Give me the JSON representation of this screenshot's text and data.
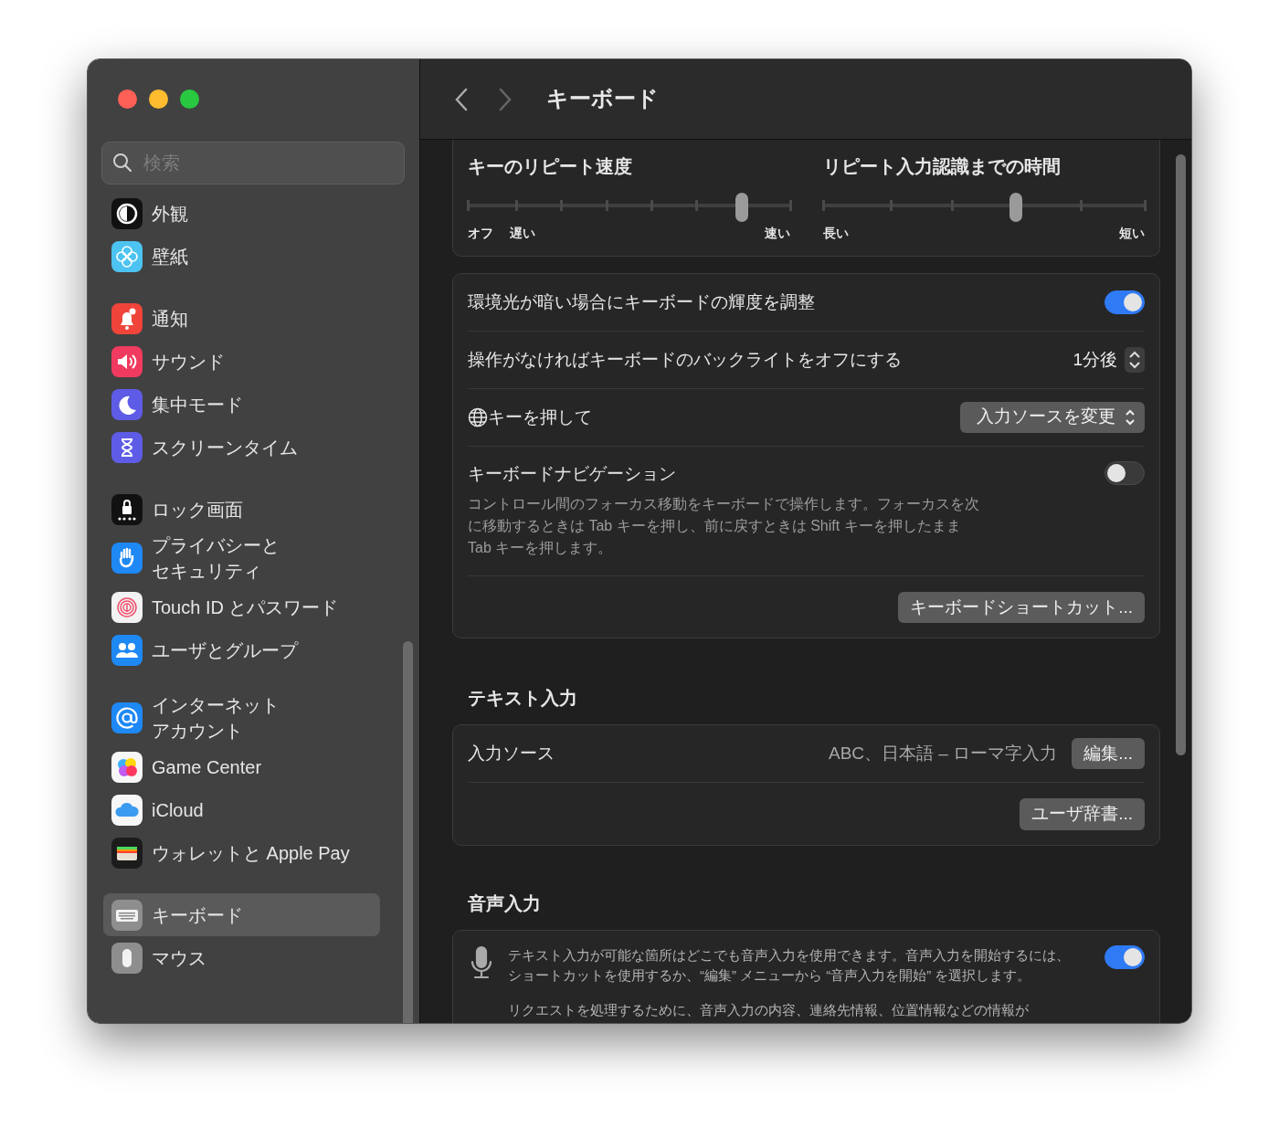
{
  "sidebar": {
    "search": {
      "placeholder": "検索"
    },
    "groups": [
      [
        {
          "kind": "appearance",
          "label": "外観",
          "selected": false
        },
        {
          "kind": "wallpaper",
          "label": "壁紙",
          "selected": false
        }
      ],
      [
        {
          "kind": "notifications",
          "label": "通知",
          "selected": false
        },
        {
          "kind": "sound",
          "label": "サウンド",
          "selected": false
        },
        {
          "kind": "focus",
          "label": "集中モード",
          "selected": false
        },
        {
          "kind": "screentime",
          "label": "スクリーンタイム",
          "selected": false
        }
      ],
      [
        {
          "kind": "lock",
          "label": "ロック画面",
          "selected": false
        },
        {
          "kind": "privacy",
          "label": "プライバシーとセキュリティ",
          "wrapped": true,
          "selected": false
        },
        {
          "kind": "touchid",
          "label": "Touch ID とパスワード",
          "selected": false
        },
        {
          "kind": "users",
          "label": "ユーザとグループ",
          "selected": false
        }
      ],
      [
        {
          "kind": "internet",
          "label": "インターネットアカウント",
          "wrapped": true,
          "selected": false
        },
        {
          "kind": "gamecenter",
          "label": "Game Center",
          "selected": false
        },
        {
          "kind": "icloud",
          "label": "iCloud",
          "selected": false
        },
        {
          "kind": "wallet",
          "label": "ウォレットと Apple Pay",
          "selected": false
        }
      ],
      [
        {
          "kind": "keyboard",
          "label": "キーボード",
          "selected": true
        },
        {
          "kind": "mouse",
          "label": "マウス",
          "selected": false
        }
      ]
    ]
  },
  "header": {
    "title": "キーボード"
  },
  "sliders": [
    {
      "kind": "speed",
      "title": "キーのリピート速度",
      "level": 0.85,
      "left_labels": [
        "オフ",
        "遅い"
      ],
      "right_label": "速い"
    },
    {
      "kind": "delay",
      "title": "リピート入力認識までの時間",
      "level": 0.6,
      "left_labels": [
        "長い"
      ],
      "right_label": "短い"
    }
  ],
  "keyboard_settings": {
    "rows": [
      {
        "kind": "toggle",
        "label": "環境光が暗い場合にキーボードの輝度を調整",
        "on": true
      },
      {
        "kind": "stepper",
        "label": "操作がなければキーボードのバックライトをオフにする",
        "value": "1分後"
      },
      {
        "kind": "popup",
        "label": "キーを押して",
        "value": "入力ソースを変更"
      },
      {
        "kind": "toggle",
        "label": "キーボードナビゲーション",
        "description": "コントロール間のフォーカス移動をキーボードで操作します。フォーカスを次に移動するときは Tab キーを押し、前に戻すときは Shift キーを押したまま Tab キーを押します。",
        "on": false
      }
    ],
    "button": "キーボードショートカット..."
  },
  "text_input": {
    "heading": "テキスト入力",
    "label": "入力ソース",
    "value": "ABC、日本語 – ローマ字入力",
    "edit_button": "編集...",
    "button": "ユーザ辞書..."
  },
  "dictation": {
    "heading": "音声入力",
    "description": "テキスト入力が可能な箇所はどこでも音声入力を使用できます。音声入力を開始するには、ショートカットを使用するか、“編集” メニューから “音声入力を開始” を選択します。",
    "on": true,
    "note": "リクエストを処理するために、音声入力の内容、連絡先情報、位置情報などの情報が"
  }
}
